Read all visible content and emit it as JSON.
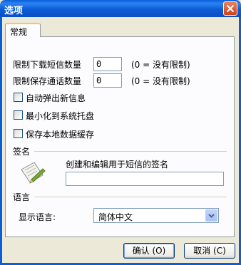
{
  "window": {
    "title": "选项"
  },
  "tabs": [
    {
      "label": "常规"
    }
  ],
  "general": {
    "download_limit_label": "限制下载短信数量",
    "download_limit_value": "0",
    "download_limit_hint": "(0 = 没有限制)",
    "save_limit_label": "限制保存通话数量",
    "save_limit_value": "0",
    "save_limit_hint": "(0 = 没有限制)",
    "checkboxes": [
      {
        "label": "自动弹出新信息",
        "checked": false
      },
      {
        "label": "最小化到系统托盘",
        "checked": false
      },
      {
        "label": "保存本地数据缓存",
        "checked": false
      }
    ]
  },
  "signature": {
    "group_label": "签名",
    "description": "创建和编辑用于短信的签名",
    "value": "",
    "icon": "pen-and-paper-icon"
  },
  "language": {
    "group_label": "语言",
    "display_label": "显示语言:",
    "selected": "简体中文"
  },
  "buttons": {
    "ok": "确认 (O)",
    "cancel": "取消 (C)"
  }
}
